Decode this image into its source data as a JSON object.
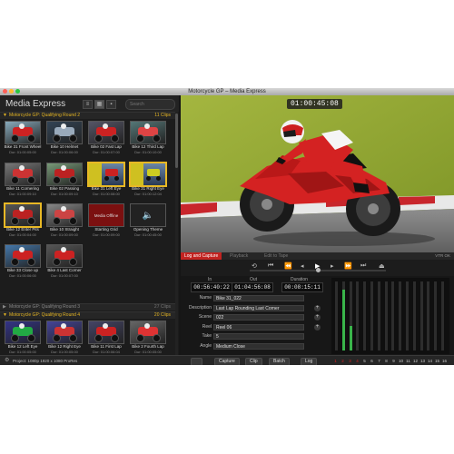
{
  "window": {
    "title": "Motorcycle GP – Media Express",
    "lights": [
      "#ff5f57",
      "#ffbd2e",
      "#28c840"
    ]
  },
  "app": {
    "title": "Media Express",
    "search_placeholder": "Search",
    "view_buttons": [
      "list-view-icon",
      "grid-view-icon",
      "scene-view-icon"
    ]
  },
  "bins": [
    {
      "name": "Motorcycle GP: Qualifying Round 2",
      "count": "11 Clips",
      "expanded": true
    },
    {
      "name": "Motorcycle GP: Qualifying Round 3",
      "count": "27 Clips",
      "expanded": false
    },
    {
      "name": "Motorcycle GP: Qualifying Round 4",
      "count": "20 Clips",
      "expanded": true
    }
  ],
  "clips": [
    {
      "name": "Bike 31 Front Wheel",
      "dur": "Dur: 01:00:05:00"
    },
    {
      "name": "Bike 10 Helmet",
      "dur": "Dur: 01:00:06:00"
    },
    {
      "name": "Bike 02 Fast Lap",
      "dur": "Dur: 01:00:07:00"
    },
    {
      "name": "Bike 12 Third Lap",
      "dur": "Dur: 01:00:10:00"
    },
    {
      "name": "Bike 11 Cornering",
      "dur": "Dur: 01:00:09:10"
    },
    {
      "name": "Bike 02 Passing",
      "dur": "Dur: 01:00:09:10"
    },
    {
      "name": "Bike 31 Left Eye",
      "dur": "Dur: 01:00:08:00"
    },
    {
      "name": "Bike 31 Right Eye",
      "dur": "Dur: 01:00:12:04"
    },
    {
      "name": "Bike 12 Enter Pits",
      "dur": "Dur: 01:00:04:00"
    },
    {
      "name": "Bike 10 Straight",
      "dur": "Dur: 01:00:09:00"
    },
    {
      "name": "Starting Grid",
      "dur": "Dur: 01:00:09:00"
    },
    {
      "name": "Opening Theme",
      "dur": "Dur: 01:00:45:00"
    },
    {
      "name": "Bike 33 Close up",
      "dur": "Dur: 01:00:06:00"
    },
    {
      "name": "Bike 4 Last Corner",
      "dur": "Dur: 01:00:07:00"
    },
    {
      "name": "Bike 12 Left Eye",
      "dur": "Dur: 01:00:05:00"
    },
    {
      "name": "Bike 12 Right Eye",
      "dur": "Dur: 01:00:05:00"
    },
    {
      "name": "Bike 11 First Lap",
      "dur": "Dur: 01:00:06:04"
    },
    {
      "name": "Bike 2 Fourth Lap",
      "dur": "Dur: 01:00:05:00"
    }
  ],
  "media_offline_label": "Media Offline",
  "viewer": {
    "timecode": "01:00:45:08"
  },
  "tabs": [
    "Log and Capture",
    "Playback",
    "Edit to Tape"
  ],
  "deck_status": "VTR OK",
  "timecodes": {
    "in_label": "In",
    "in": "00:56:40:22",
    "out_label": "Out",
    "out": "01:04:56:08",
    "dur_label": "Duration",
    "dur": "00:08:15:11"
  },
  "fields": [
    {
      "label": "Name",
      "value": "Bike 31_022",
      "plus": false
    },
    {
      "label": "Description",
      "value": "Last Lap Rounding Last Corner",
      "plus": true
    },
    {
      "label": "Scene",
      "value": "022",
      "plus": true
    },
    {
      "label": "Reel",
      "value": "Reel 06",
      "plus": true
    },
    {
      "label": "Take",
      "value": "5",
      "plus": false
    },
    {
      "label": "Angle",
      "value": "Medium Close",
      "plus": false
    }
  ],
  "audio_levels": [
    0.0,
    0.88,
    0.35,
    0.0,
    0.0,
    0.0,
    0.0,
    0.0,
    0.0,
    0.0,
    0.0,
    0.0,
    0.0,
    0.0,
    0.0,
    0.0
  ],
  "bottom": {
    "project": "Project: 1080p 1920 x 1080 ProRes",
    "capture": "Capture",
    "clip": "Clip",
    "batch": "Batch",
    "log": "Log",
    "channels": [
      "1",
      "2",
      "3",
      "4",
      "5",
      "6",
      "7",
      "8",
      "9",
      "10",
      "11",
      "12",
      "13",
      "14",
      "15",
      "16"
    ]
  }
}
